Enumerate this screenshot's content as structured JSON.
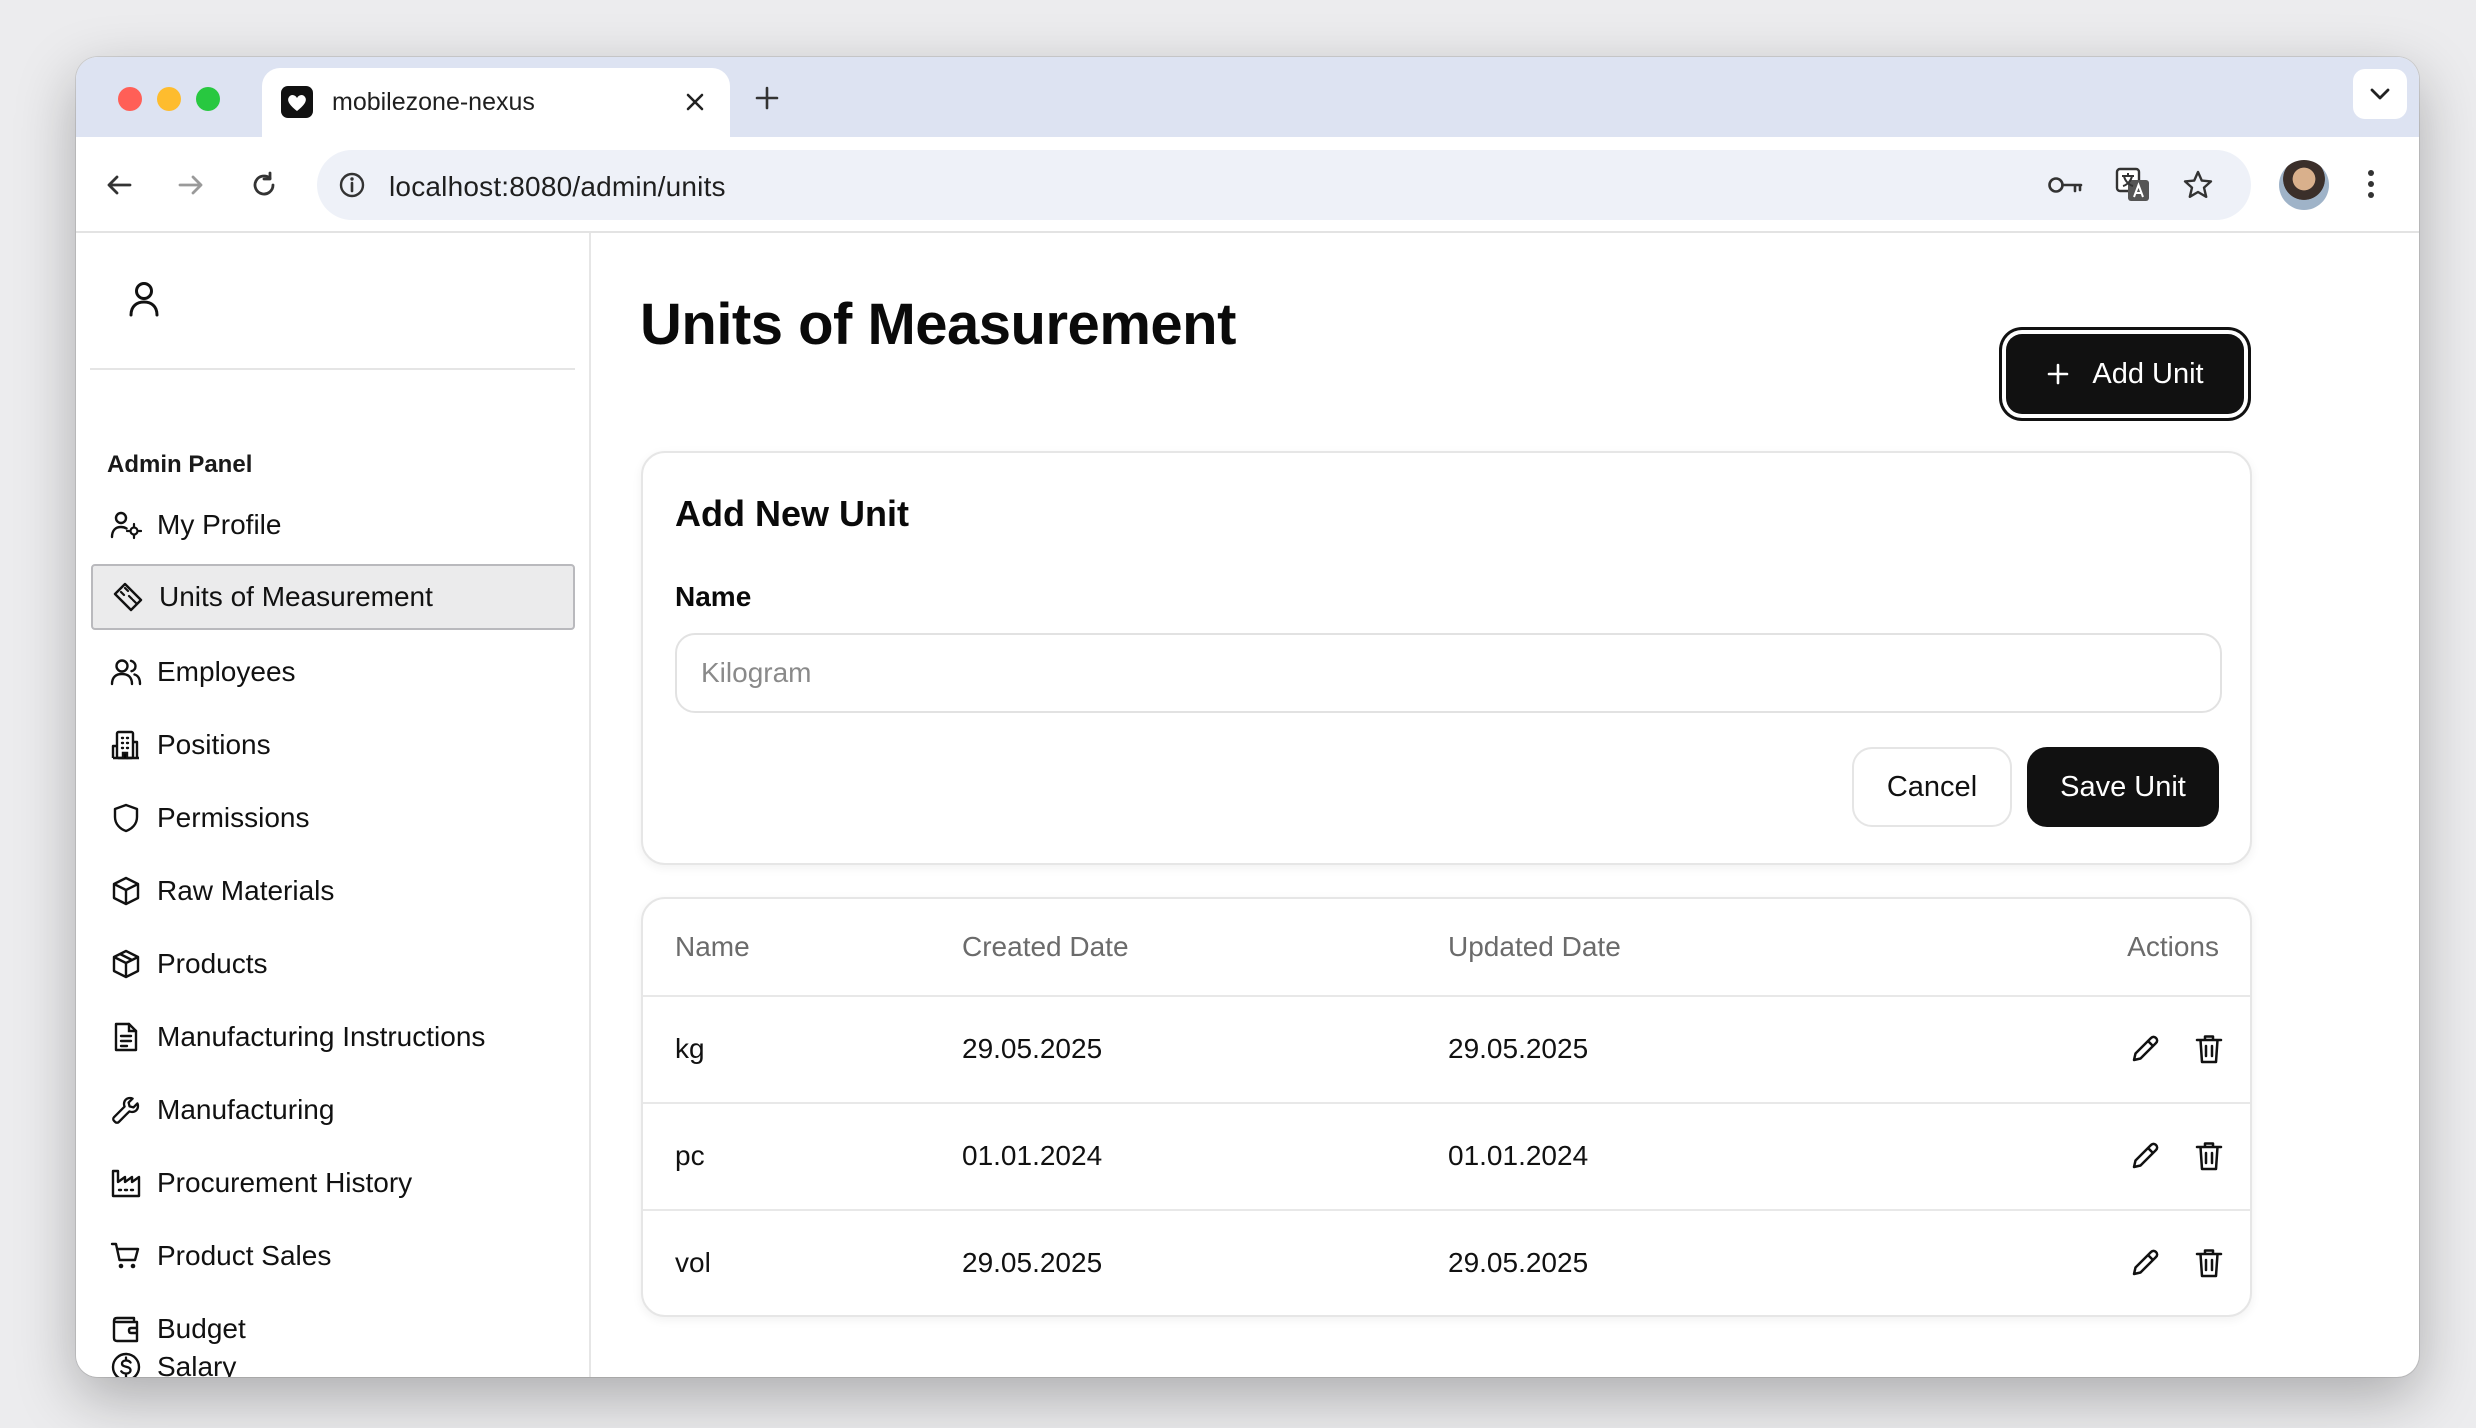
{
  "browser": {
    "tab_title": "mobilezone-nexus",
    "url": "localhost:8080/admin/units"
  },
  "sidebar": {
    "heading": "Admin Panel",
    "items": [
      {
        "label": "My Profile",
        "icon": "user-cog-icon",
        "active": false
      },
      {
        "label": "Units of Measurement",
        "icon": "ruler-icon",
        "active": true
      },
      {
        "label": "Employees",
        "icon": "users-icon",
        "active": false
      },
      {
        "label": "Positions",
        "icon": "building-icon",
        "active": false
      },
      {
        "label": "Permissions",
        "icon": "shield-icon",
        "active": false
      },
      {
        "label": "Raw Materials",
        "icon": "box-icon",
        "active": false
      },
      {
        "label": "Products",
        "icon": "package-icon",
        "active": false
      },
      {
        "label": "Manufacturing Instructions",
        "icon": "document-icon",
        "active": false
      },
      {
        "label": "Manufacturing",
        "icon": "wrench-icon",
        "active": false
      },
      {
        "label": "Procurement History",
        "icon": "factory-icon",
        "active": false
      },
      {
        "label": "Product Sales",
        "icon": "cart-icon",
        "active": false
      },
      {
        "label": "Budget",
        "icon": "wallet-icon",
        "active": false
      },
      {
        "label": "Salary",
        "icon": "dollar-circle-icon",
        "active": false
      }
    ]
  },
  "main": {
    "title": "Units of Measurement",
    "add_button_label": "Add Unit",
    "form": {
      "title": "Add New Unit",
      "name_label": "Name",
      "name_placeholder": "Kilogram",
      "name_value": "",
      "cancel_label": "Cancel",
      "save_label": "Save Unit"
    },
    "table": {
      "headers": [
        "Name",
        "Created Date",
        "Updated Date",
        "Actions"
      ],
      "rows": [
        {
          "name": "kg",
          "created": "29.05.2025",
          "updated": "29.05.2025"
        },
        {
          "name": "pc",
          "created": "01.01.2024",
          "updated": "01.01.2024"
        },
        {
          "name": "vol",
          "created": "29.05.2025",
          "updated": "29.05.2025"
        }
      ]
    }
  },
  "colors": {
    "accent": "#111111",
    "tabstrip": "#dde3f2",
    "active_nav_bg": "#ebebec"
  }
}
